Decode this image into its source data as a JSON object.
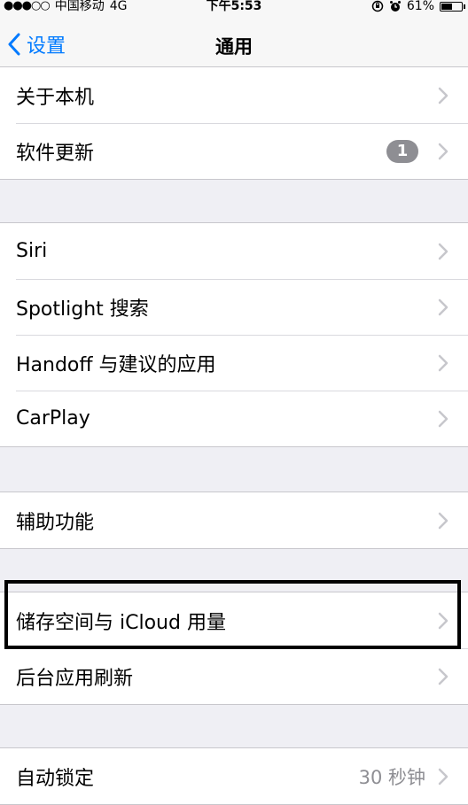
{
  "status_bar": {
    "signal_dots": "●●●○○",
    "carrier": "中国移动",
    "network": "4G",
    "time": "下午5:53",
    "battery_percent": "61%",
    "battery_level": 0.61,
    "icons": [
      "orientation-lock-icon",
      "alarm-icon",
      "battery-icon"
    ]
  },
  "nav": {
    "back_label": "设置",
    "title": "通用"
  },
  "sections": [
    {
      "rows": [
        {
          "label": "关于本机"
        },
        {
          "label": "软件更新",
          "badge": "1"
        }
      ]
    },
    {
      "rows": [
        {
          "label": "Siri"
        },
        {
          "label": "Spotlight 搜索"
        },
        {
          "label": "Handoff 与建议的应用"
        },
        {
          "label": "CarPlay"
        }
      ]
    },
    {
      "rows": [
        {
          "label": "辅助功能"
        }
      ]
    },
    {
      "rows": [
        {
          "label": "储存空间与 iCloud 用量"
        },
        {
          "label": "后台应用刷新"
        }
      ]
    },
    {
      "rows": [
        {
          "label": "自动锁定",
          "value": "30 秒钟"
        }
      ]
    }
  ],
  "colors": {
    "accent": "#007aff",
    "background": "#efeff4",
    "highlight_border": "#000000"
  }
}
